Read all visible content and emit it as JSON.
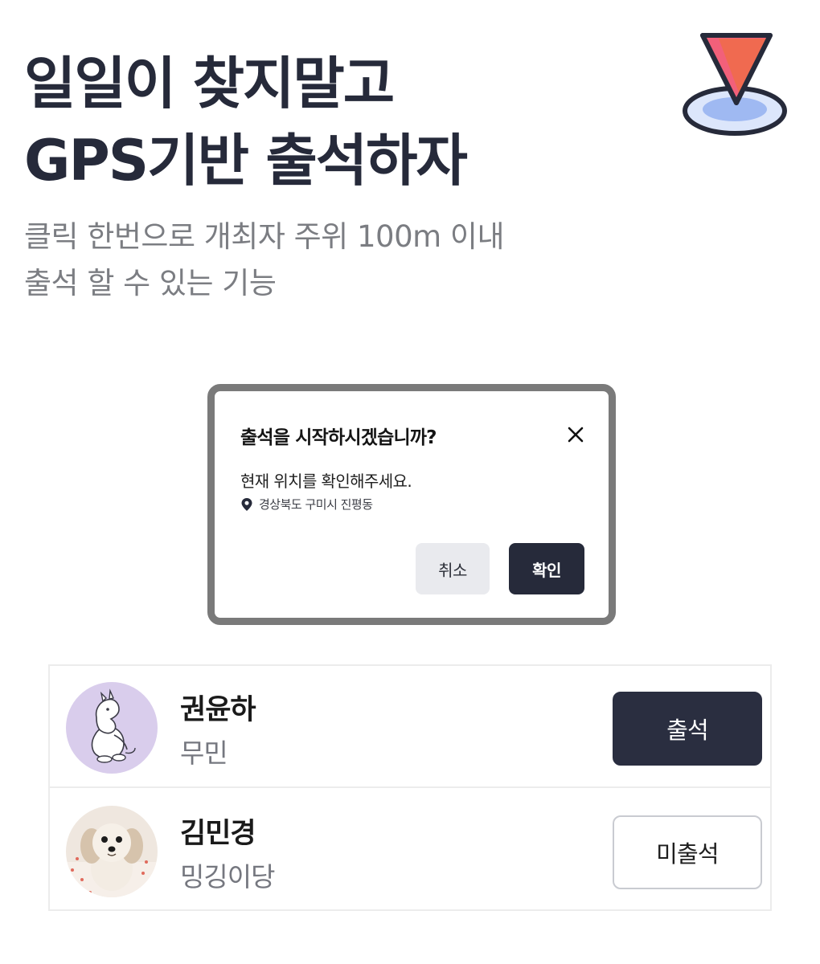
{
  "hero": {
    "title_line1": "일일이 찾지말고",
    "title_line2": "GPS기반 출석하자",
    "desc_line1": "클릭 한번으로 개최자 주위 100m 이내",
    "desc_line2": "출석 할 수 있는 기능",
    "logo_icon": "map-pin-location-icon"
  },
  "dialog": {
    "title": "출석을 시작하시겠습니까?",
    "message": "현재 위치를 확인해주세요.",
    "location": "경상북도 구미시 진평동",
    "cancel_label": "취소",
    "confirm_label": "확인"
  },
  "members": [
    {
      "name": "권윤하",
      "nickname": "무민",
      "status_label": "출석",
      "attended": true,
      "avatar": "moomin-avatar"
    },
    {
      "name": "김민경",
      "nickname": "밍깅이당",
      "status_label": "미출석",
      "attended": false,
      "avatar": "puppy-avatar"
    }
  ],
  "colors": {
    "primary": "#262a3a",
    "muted_text": "#7b7d82",
    "pin_red": "#f05a4f",
    "pin_pink": "#f0507a",
    "ring_blue": "#9fb9f2",
    "avatar_lavender": "#d9cdec"
  }
}
